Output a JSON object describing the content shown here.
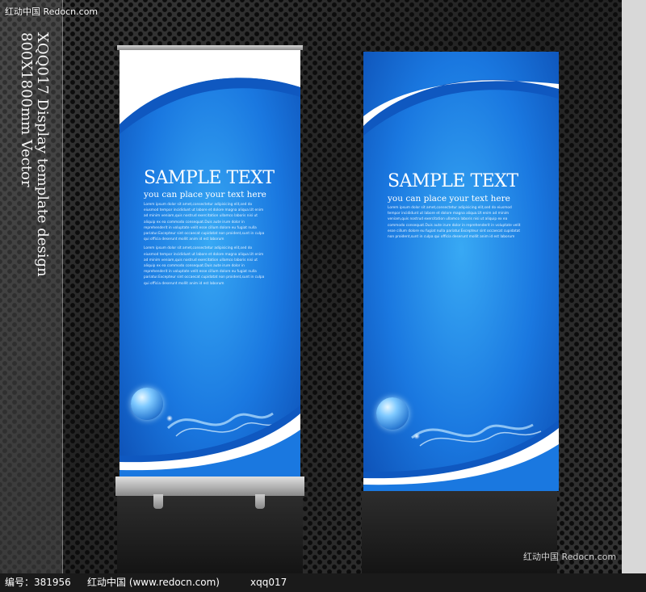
{
  "watermark_top": "红动中国 Redocn.com",
  "vertical_lines": [
    "XQQ017 Display template design",
    "800X1800mm Vector"
  ],
  "banners": [
    {
      "title": "SAMPLE TEXT",
      "subtitle": "you can place your text here",
      "paragraphs": [
        "Lorem ipsum dolor sit amet,consectetur adipisicing elit,sed do eiusmod tempor incididunt ut labore et dolore magna aliqua.Ut enim ad minim veniam,quis nostrud exercitation ullamco laboris nisi ut aliquip ex ea commodo consequat.Duis aute irure dolor in reprehenderit in voluptate velit esse cillum dolore eu fugiat nulla pariatur.Excepteur sint occaecat cupidatat non proident,sunt in culpa qui officia deserunt mollit anim id est laborum",
        "Lorem ipsum dolor sit amet,consectetur adipisicing elit,sed do eiusmod tempor incididunt ut labore et dolore magna aliqua.Ut enim ad minim veniam,quis nostrud exercitation ullamco laboris nisi ut aliquip ex ea commodo consequat.Duis aute irure dolor in reprehenderit in voluptate velit esse cillum dolore eu fugiat nulla pariatur.Excepteur sint occaecat cupidatat non proident,sunt in culpa qui officia deserunt mollit anim id est laborum"
      ]
    },
    {
      "title": "SAMPLE TEXT",
      "subtitle": "you can place your text here",
      "paragraphs": [
        "Lorem ipsum dolor sit amet,consectetur adipisicing elit,sed do eiusmod tempor incididunt ut labore et dolore magna aliqua.Ut enim ad minim veniam,quis nostrud exercitation ullamco laboris nisi ut aliquip ex ea commodo consequat.Duis aute irure dolor in reprehenderit in voluptate velit esse cillum dolore eu fugiat nulla pariatur.Excepteur sint occaecat cupidatat non proident,sunt in culpa qui officia deserunt mollit anim id est laborum"
      ]
    }
  ],
  "corner_mark": "红动中国 Redocn.com",
  "footer": {
    "id_text": "编号：381956",
    "site_text": "红动中国 (www.redocn.com)",
    "code_text": "xqq017"
  },
  "colors": {
    "banner_blue": "#1a78e0",
    "background_metal": "#2a2a2a"
  }
}
